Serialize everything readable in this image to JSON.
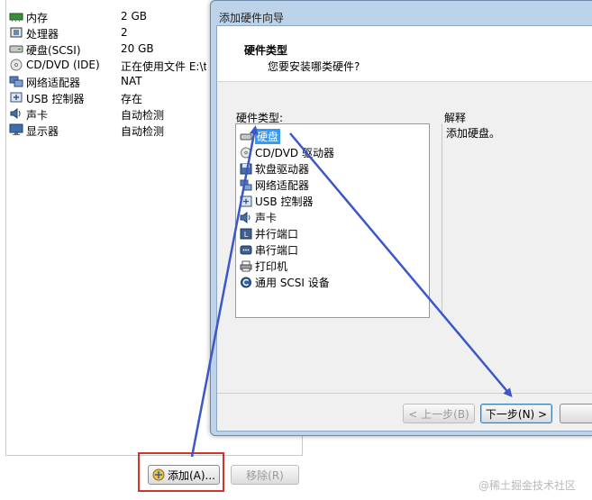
{
  "devices": [
    {
      "name": "内存",
      "value": "2 GB",
      "icon": "memory-icon"
    },
    {
      "name": "处理器",
      "value": "2",
      "icon": "processor-icon"
    },
    {
      "name": "硬盘(SCSI)",
      "value": "20 GB",
      "icon": "hard-disk-icon"
    },
    {
      "name": "CD/DVD (IDE)",
      "value": "正在使用文件 E:\\too",
      "icon": "cd-dvd-icon"
    },
    {
      "name": "网络适配器",
      "value": "NAT",
      "icon": "network-adapter-icon"
    },
    {
      "name": "USB 控制器",
      "value": "存在",
      "icon": "usb-controller-icon"
    },
    {
      "name": "声卡",
      "value": "自动检测",
      "icon": "sound-card-icon"
    },
    {
      "name": "显示器",
      "value": "自动检测",
      "icon": "display-icon"
    }
  ],
  "buttons": {
    "add": "添加(A)...",
    "remove": "移除(R)"
  },
  "wizard": {
    "title": "添加硬件向导",
    "header_title": "硬件类型",
    "header_subtitle": "您要安装哪类硬件?",
    "types_label": "硬件类型:",
    "explain_label": "解释",
    "explain_text": "添加硬盘。",
    "hardware_types": [
      {
        "label": "硬盘",
        "icon": "hard-disk-icon",
        "selected": true
      },
      {
        "label": "CD/DVD 驱动器",
        "icon": "cd-dvd-icon"
      },
      {
        "label": "软盘驱动器",
        "icon": "floppy-drive-icon"
      },
      {
        "label": "网络适配器",
        "icon": "network-adapter-icon"
      },
      {
        "label": "USB 控制器",
        "icon": "usb-controller-icon"
      },
      {
        "label": "声卡",
        "icon": "sound-card-icon"
      },
      {
        "label": "并行端口",
        "icon": "parallel-port-icon"
      },
      {
        "label": "串行端口",
        "icon": "serial-port-icon"
      },
      {
        "label": "打印机",
        "icon": "printer-icon"
      },
      {
        "label": "通用 SCSI 设备",
        "icon": "scsi-device-icon"
      }
    ],
    "back_button": "< 上一步(B)",
    "next_button": "下一步(N) >"
  },
  "watermark": "@稀土掘金技术社区",
  "colors": {
    "highlight": "#d2332c",
    "arrow": "#3b57c8",
    "selection": "#3399ff"
  }
}
